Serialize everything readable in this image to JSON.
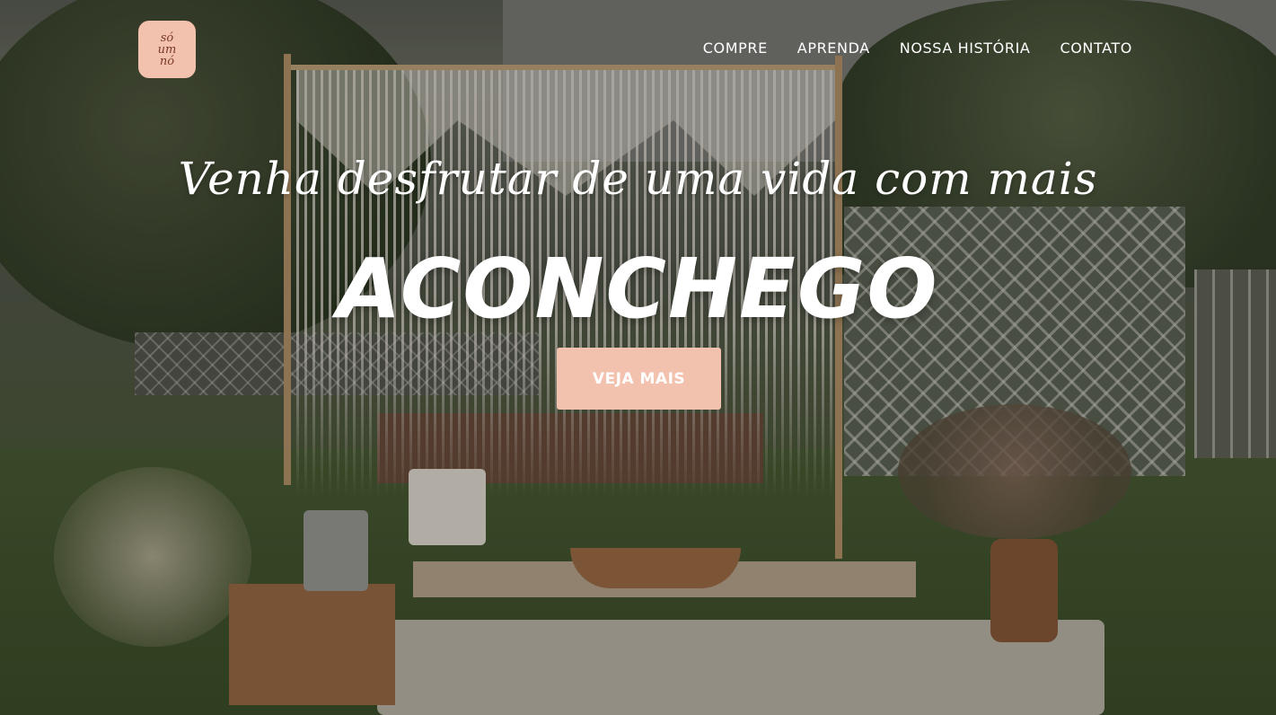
{
  "logo": {
    "line1": "só",
    "line2": "um",
    "line3": "nó"
  },
  "nav": {
    "items": [
      {
        "label": "COMPRE"
      },
      {
        "label": "APRENDA"
      },
      {
        "label": "NOSSA HISTÓRIA"
      },
      {
        "label": "CONTATO"
      }
    ]
  },
  "hero": {
    "tagline": "Venha desfrutar de uma vida com mais",
    "headline": "ACONCHEGO",
    "cta_label": "VEJA MAIS"
  },
  "colors": {
    "accent": "#f3c2ae",
    "text_on_hero": "#ffffff"
  }
}
